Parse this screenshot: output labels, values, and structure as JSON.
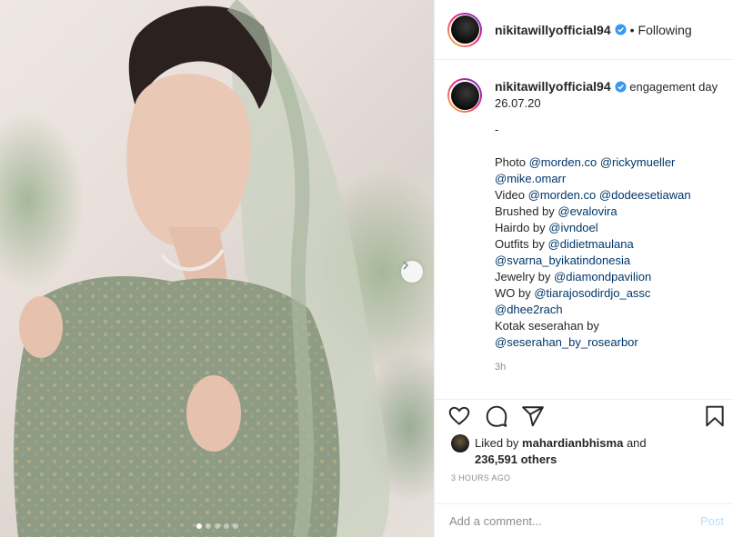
{
  "post": {
    "username": "nikitawillyofficial94",
    "verified": true,
    "follow_status": "Following",
    "separator": "•"
  },
  "caption": {
    "first_line": "engagement day 26.07.20",
    "lines": [
      "-",
      "",
      "Photo @morden.co @rickymueller",
      "@mike.omarr",
      "Video @morden.co @dodeesetiawan",
      "Brushed by @evalovira",
      "Hairdo by @ivndoel",
      "Outfits by @didietmaulana",
      "@svarna_byikatindonesia",
      "Jewelry by @diamondpavilion",
      "WO by @tiarajosodirdjo_assc",
      "@dhee2rach",
      "Kotak seserahan by",
      "@seserahan_by_rosearbor"
    ],
    "time": "3h"
  },
  "likes": {
    "prefix": "Liked by",
    "user": "mahardianbhisma",
    "and": "and",
    "others": "236,591 others"
  },
  "timestamp": "3 HOURS AGO",
  "comment": {
    "placeholder": "Add a comment...",
    "post_label": "Post"
  },
  "carousel": {
    "slides": 5,
    "active": 1
  },
  "icons": {
    "verified": "verified-badge-icon",
    "like": "heart-icon",
    "comment": "comment-icon",
    "share": "share-icon",
    "save": "bookmark-icon",
    "next": "chevron-right-icon"
  },
  "colors": {
    "verified": "#3897f0",
    "link": "#00376b",
    "muted": "#8e8e8e",
    "post_disabled": "#b2dffc"
  }
}
